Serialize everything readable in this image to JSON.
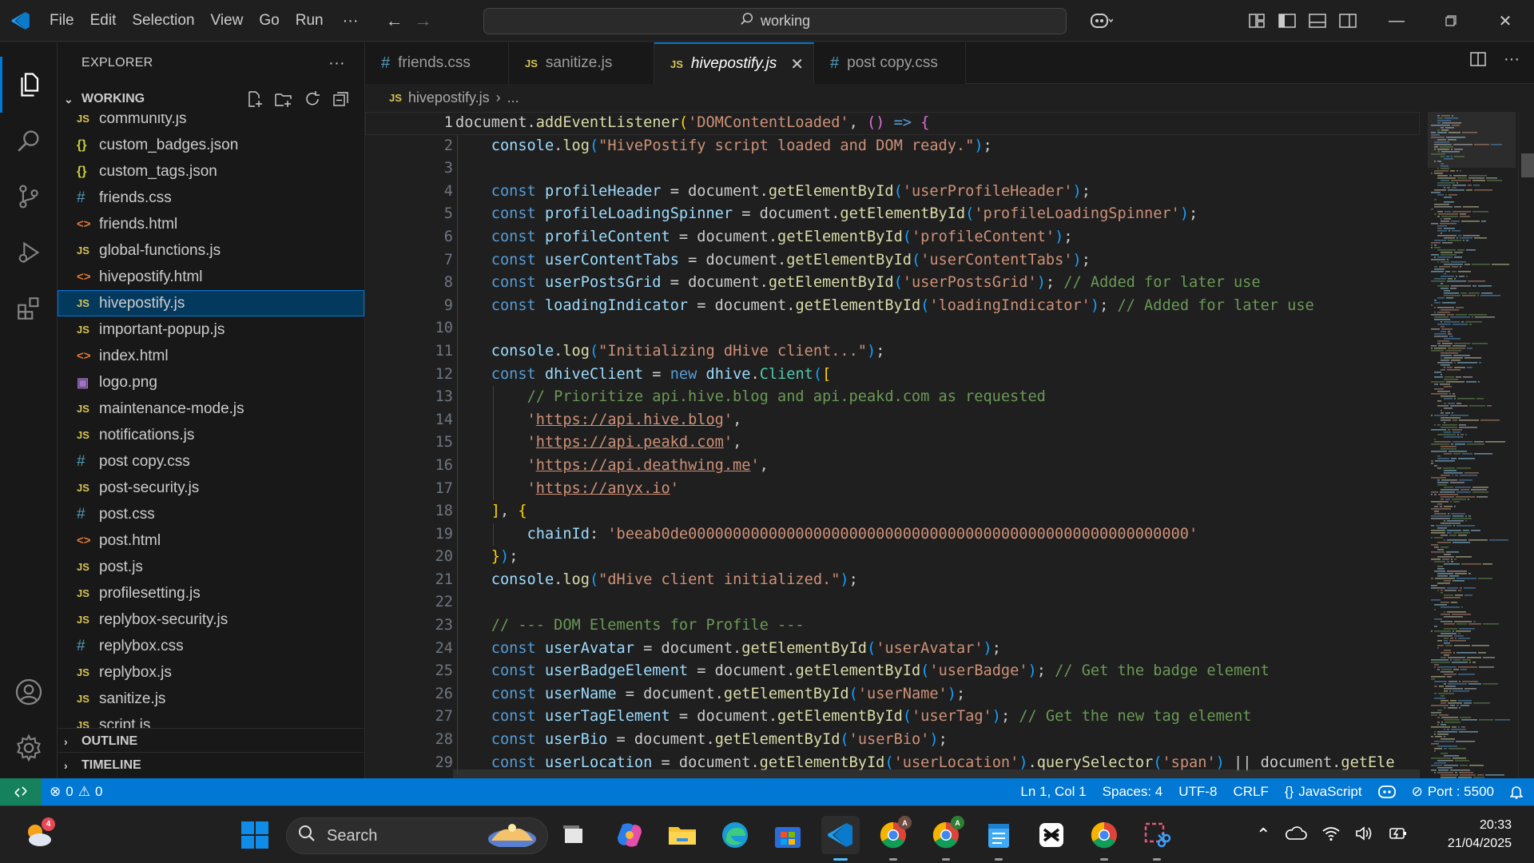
{
  "menu": [
    "File",
    "Edit",
    "Selection",
    "View",
    "Go",
    "Run"
  ],
  "command_center": "working",
  "explorer": {
    "title": "EXPLORER",
    "folder": "WORKING",
    "files": [
      {
        "name": "community.js",
        "type": "js"
      },
      {
        "name": "custom_badges.json",
        "type": "json"
      },
      {
        "name": "custom_tags.json",
        "type": "json"
      },
      {
        "name": "friends.css",
        "type": "css"
      },
      {
        "name": "friends.html",
        "type": "html"
      },
      {
        "name": "global-functions.js",
        "type": "js"
      },
      {
        "name": "hivepostify.html",
        "type": "html"
      },
      {
        "name": "hivepostify.js",
        "type": "js",
        "selected": true
      },
      {
        "name": "important-popup.js",
        "type": "js"
      },
      {
        "name": "index.html",
        "type": "html"
      },
      {
        "name": "logo.png",
        "type": "png"
      },
      {
        "name": "maintenance-mode.js",
        "type": "js"
      },
      {
        "name": "notifications.js",
        "type": "js"
      },
      {
        "name": "post copy.css",
        "type": "css"
      },
      {
        "name": "post-security.js",
        "type": "js"
      },
      {
        "name": "post.css",
        "type": "css"
      },
      {
        "name": "post.html",
        "type": "html"
      },
      {
        "name": "post.js",
        "type": "js"
      },
      {
        "name": "profilesetting.js",
        "type": "js"
      },
      {
        "name": "replybox-security.js",
        "type": "js"
      },
      {
        "name": "replybox.css",
        "type": "css"
      },
      {
        "name": "replybox.js",
        "type": "js"
      },
      {
        "name": "sanitize.js",
        "type": "js"
      },
      {
        "name": "script.js",
        "type": "js"
      }
    ],
    "outline": "OUTLINE",
    "timeline": "TIMELINE"
  },
  "tabs": [
    {
      "label": "friends.css",
      "type": "css"
    },
    {
      "label": "sanitize.js",
      "type": "js"
    },
    {
      "label": "hivepostify.js",
      "type": "js",
      "active": true
    },
    {
      "label": "post copy.css",
      "type": "css"
    }
  ],
  "breadcrumb": {
    "file": "hivepostify.js",
    "rest": "..."
  },
  "code_lines": [
    [
      [
        "plain",
        "document."
      ],
      [
        "fn",
        "addEventListener"
      ],
      [
        "br1",
        "("
      ],
      [
        "str",
        "'DOMContentLoaded'"
      ],
      [
        "plain",
        ", "
      ],
      [
        "br2",
        "()"
      ],
      [
        "plain",
        " "
      ],
      [
        "kw",
        "=>"
      ],
      [
        "plain",
        " "
      ],
      [
        "br2",
        "{"
      ]
    ],
    [
      [
        "plain",
        "    "
      ],
      [
        "var",
        "console"
      ],
      [
        "plain",
        "."
      ],
      [
        "fn",
        "log"
      ],
      [
        "br3",
        "("
      ],
      [
        "str",
        "\"HivePostify script loaded and DOM ready.\""
      ],
      [
        "br3",
        ")"
      ],
      [
        "plain",
        ";"
      ]
    ],
    [],
    [
      [
        "plain",
        "    "
      ],
      [
        "kw",
        "const"
      ],
      [
        "plain",
        " "
      ],
      [
        "var",
        "profileHeader"
      ],
      [
        "plain",
        " = document."
      ],
      [
        "fn",
        "getElementById"
      ],
      [
        "br3",
        "("
      ],
      [
        "str",
        "'userProfileHeader'"
      ],
      [
        "br3",
        ")"
      ],
      [
        "plain",
        ";"
      ]
    ],
    [
      [
        "plain",
        "    "
      ],
      [
        "kw",
        "const"
      ],
      [
        "plain",
        " "
      ],
      [
        "var",
        "profileLoadingSpinner"
      ],
      [
        "plain",
        " = document."
      ],
      [
        "fn",
        "getElementById"
      ],
      [
        "br3",
        "("
      ],
      [
        "str",
        "'profileLoadingSpinner'"
      ],
      [
        "br3",
        ")"
      ],
      [
        "plain",
        ";"
      ]
    ],
    [
      [
        "plain",
        "    "
      ],
      [
        "kw",
        "const"
      ],
      [
        "plain",
        " "
      ],
      [
        "var",
        "profileContent"
      ],
      [
        "plain",
        " = document."
      ],
      [
        "fn",
        "getElementById"
      ],
      [
        "br3",
        "("
      ],
      [
        "str",
        "'profileContent'"
      ],
      [
        "br3",
        ")"
      ],
      [
        "plain",
        ";"
      ]
    ],
    [
      [
        "plain",
        "    "
      ],
      [
        "kw",
        "const"
      ],
      [
        "plain",
        " "
      ],
      [
        "var",
        "userContentTabs"
      ],
      [
        "plain",
        " = document."
      ],
      [
        "fn",
        "getElementById"
      ],
      [
        "br3",
        "("
      ],
      [
        "str",
        "'userContentTabs'"
      ],
      [
        "br3",
        ")"
      ],
      [
        "plain",
        ";"
      ]
    ],
    [
      [
        "plain",
        "    "
      ],
      [
        "kw",
        "const"
      ],
      [
        "plain",
        " "
      ],
      [
        "var",
        "userPostsGrid"
      ],
      [
        "plain",
        " = document."
      ],
      [
        "fn",
        "getElementById"
      ],
      [
        "br3",
        "("
      ],
      [
        "str",
        "'userPostsGrid'"
      ],
      [
        "br3",
        ")"
      ],
      [
        "plain",
        "; "
      ],
      [
        "cm",
        "// Added for later use"
      ]
    ],
    [
      [
        "plain",
        "    "
      ],
      [
        "kw",
        "const"
      ],
      [
        "plain",
        " "
      ],
      [
        "var",
        "loadingIndicator"
      ],
      [
        "plain",
        " = document."
      ],
      [
        "fn",
        "getElementById"
      ],
      [
        "br3",
        "("
      ],
      [
        "str",
        "'loadingIndicator'"
      ],
      [
        "br3",
        ")"
      ],
      [
        "plain",
        "; "
      ],
      [
        "cm",
        "// Added for later use"
      ]
    ],
    [],
    [
      [
        "plain",
        "    "
      ],
      [
        "var",
        "console"
      ],
      [
        "plain",
        "."
      ],
      [
        "fn",
        "log"
      ],
      [
        "br3",
        "("
      ],
      [
        "str",
        "\"Initializing dHive client...\""
      ],
      [
        "br3",
        ")"
      ],
      [
        "plain",
        ";"
      ]
    ],
    [
      [
        "plain",
        "    "
      ],
      [
        "kw",
        "const"
      ],
      [
        "plain",
        " "
      ],
      [
        "var",
        "dhiveClient"
      ],
      [
        "plain",
        " = "
      ],
      [
        "kw",
        "new"
      ],
      [
        "plain",
        " "
      ],
      [
        "var",
        "dhive"
      ],
      [
        "plain",
        "."
      ],
      [
        "cls",
        "Client"
      ],
      [
        "br3",
        "("
      ],
      [
        "br1",
        "["
      ]
    ],
    [
      [
        "plain",
        "        "
      ],
      [
        "cm",
        "// Prioritize api.hive.blog and api.peakd.com as requested"
      ]
    ],
    [
      [
        "plain",
        "        "
      ],
      [
        "str",
        "'"
      ],
      [
        "url",
        "https://api.hive.blog"
      ],
      [
        "str",
        "'"
      ],
      [
        "plain",
        ","
      ]
    ],
    [
      [
        "plain",
        "        "
      ],
      [
        "str",
        "'"
      ],
      [
        "url",
        "https://api.peakd.com"
      ],
      [
        "str",
        "'"
      ],
      [
        "plain",
        ","
      ]
    ],
    [
      [
        "plain",
        "        "
      ],
      [
        "str",
        "'"
      ],
      [
        "url",
        "https://api.deathwing.me"
      ],
      [
        "str",
        "'"
      ],
      [
        "plain",
        ","
      ]
    ],
    [
      [
        "plain",
        "        "
      ],
      [
        "str",
        "'"
      ],
      [
        "url",
        "https://anyx.io"
      ],
      [
        "str",
        "'"
      ]
    ],
    [
      [
        "plain",
        "    "
      ],
      [
        "br1",
        "]"
      ],
      [
        "plain",
        ", "
      ],
      [
        "br1",
        "{"
      ]
    ],
    [
      [
        "plain",
        "        "
      ],
      [
        "var",
        "chainId"
      ],
      [
        "plain",
        ": "
      ],
      [
        "str",
        "'beeab0de00000000000000000000000000000000000000000000000000000000'"
      ]
    ],
    [
      [
        "plain",
        "    "
      ],
      [
        "br1",
        "}"
      ],
      [
        "br3",
        ")"
      ],
      [
        "plain",
        ";"
      ]
    ],
    [
      [
        "plain",
        "    "
      ],
      [
        "var",
        "console"
      ],
      [
        "plain",
        "."
      ],
      [
        "fn",
        "log"
      ],
      [
        "br3",
        "("
      ],
      [
        "str",
        "\"dHive client initialized.\""
      ],
      [
        "br3",
        ")"
      ],
      [
        "plain",
        ";"
      ]
    ],
    [],
    [
      [
        "plain",
        "    "
      ],
      [
        "cm",
        "// --- DOM Elements for Profile ---"
      ]
    ],
    [
      [
        "plain",
        "    "
      ],
      [
        "kw",
        "const"
      ],
      [
        "plain",
        " "
      ],
      [
        "var",
        "userAvatar"
      ],
      [
        "plain",
        " = document."
      ],
      [
        "fn",
        "getElementById"
      ],
      [
        "br3",
        "("
      ],
      [
        "str",
        "'userAvatar'"
      ],
      [
        "br3",
        ")"
      ],
      [
        "plain",
        ";"
      ]
    ],
    [
      [
        "plain",
        "    "
      ],
      [
        "kw",
        "const"
      ],
      [
        "plain",
        " "
      ],
      [
        "var",
        "userBadgeElement"
      ],
      [
        "plain",
        " = document."
      ],
      [
        "fn",
        "getElementById"
      ],
      [
        "br3",
        "("
      ],
      [
        "str",
        "'userBadge'"
      ],
      [
        "br3",
        ")"
      ],
      [
        "plain",
        "; "
      ],
      [
        "cm",
        "// Get the badge element"
      ]
    ],
    [
      [
        "plain",
        "    "
      ],
      [
        "kw",
        "const"
      ],
      [
        "plain",
        " "
      ],
      [
        "var",
        "userName"
      ],
      [
        "plain",
        " = document."
      ],
      [
        "fn",
        "getElementById"
      ],
      [
        "br3",
        "("
      ],
      [
        "str",
        "'userName'"
      ],
      [
        "br3",
        ")"
      ],
      [
        "plain",
        ";"
      ]
    ],
    [
      [
        "plain",
        "    "
      ],
      [
        "kw",
        "const"
      ],
      [
        "plain",
        " "
      ],
      [
        "var",
        "userTagElement"
      ],
      [
        "plain",
        " = document."
      ],
      [
        "fn",
        "getElementById"
      ],
      [
        "br3",
        "("
      ],
      [
        "str",
        "'userTag'"
      ],
      [
        "br3",
        ")"
      ],
      [
        "plain",
        "; "
      ],
      [
        "cm",
        "// Get the new tag element"
      ]
    ],
    [
      [
        "plain",
        "    "
      ],
      [
        "kw",
        "const"
      ],
      [
        "plain",
        " "
      ],
      [
        "var",
        "userBio"
      ],
      [
        "plain",
        " = document."
      ],
      [
        "fn",
        "getElementById"
      ],
      [
        "br3",
        "("
      ],
      [
        "str",
        "'userBio'"
      ],
      [
        "br3",
        ")"
      ],
      [
        "plain",
        ";"
      ]
    ],
    [
      [
        "plain",
        "    "
      ],
      [
        "kw",
        "const"
      ],
      [
        "plain",
        " "
      ],
      [
        "var",
        "userLocation"
      ],
      [
        "plain",
        " = document."
      ],
      [
        "fn",
        "getElementById"
      ],
      [
        "br3",
        "("
      ],
      [
        "str",
        "'userLocation'"
      ],
      [
        "br3",
        ")"
      ],
      [
        "plain",
        "."
      ],
      [
        "fn",
        "querySelector"
      ],
      [
        "br3",
        "("
      ],
      [
        "str",
        "'span'"
      ],
      [
        "br3",
        ")"
      ],
      [
        "plain",
        " || document."
      ],
      [
        "fn",
        "getEle"
      ]
    ]
  ],
  "status": {
    "errors": "0",
    "warnings": "0",
    "position": "Ln 1, Col 1",
    "spaces": "Spaces: 4",
    "encoding": "UTF-8",
    "eol": "CRLF",
    "language": "JavaScript",
    "port": "Port : 5500"
  },
  "taskbar": {
    "search_placeholder": "Search",
    "weather_badge": "4",
    "time": "20:33",
    "date": "21/04/2025"
  },
  "colors": {
    "accent": "#0078d4",
    "selection": "#04395e",
    "statusbar": "#0078d4"
  }
}
